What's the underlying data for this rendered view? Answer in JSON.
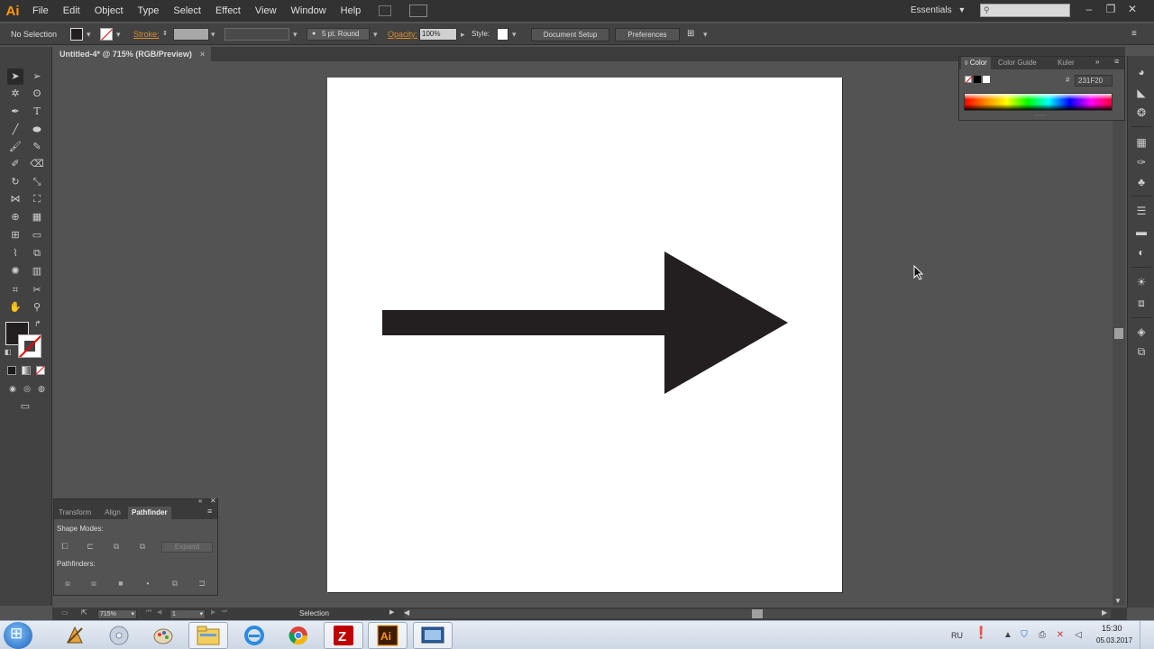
{
  "app": {
    "logo": "Ai",
    "title": "Adobe Illustrator"
  },
  "menu": [
    "File",
    "Edit",
    "Object",
    "Type",
    "Select",
    "Effect",
    "View",
    "Window",
    "Help"
  ],
  "workspace": {
    "label": "Essentials",
    "arrow": "▾"
  },
  "control_bar": {
    "selection_label": "No Selection",
    "stroke_label": "Stroke:",
    "brush_label": "5 pt. Round",
    "opacity_label": "Opacity:",
    "opacity_value": "100%",
    "style_label": "Style:",
    "document_setup": "Document Setup",
    "preferences": "Preferences"
  },
  "document_tab": {
    "title": "Untitled-4* @ 715% (RGB/Preview)",
    "close": "×"
  },
  "color_panel": {
    "tabs": [
      "Color",
      "Color Guide",
      "Kuler"
    ],
    "hex_value": "231F20"
  },
  "pathfinder_panel": {
    "tabs": [
      "Transform",
      "Align",
      "Pathfinder"
    ],
    "shape_modes_label": "Shape Modes:",
    "pathfinders_label": "Pathfinders:",
    "expand_label": "Expand"
  },
  "status_bar": {
    "zoom": "715%",
    "page": "1",
    "status": "Selection"
  },
  "taskbar": {
    "language": "RU",
    "time": "15:30",
    "date": "05.03.2017"
  },
  "colors": {
    "fill": "#231f20",
    "app_accent": "#ff9a00",
    "background": "#535353",
    "artboard": "#ffffff"
  },
  "icons": {
    "tools": [
      "selection-tool-icon",
      "direct-selection-tool-icon",
      "magic-wand-icon",
      "lasso-icon",
      "pen-tool-icon",
      "type-tool-icon",
      "line-tool-icon",
      "ellipse-tool-icon",
      "paintbrush-icon",
      "pencil-icon",
      "blob-brush-icon",
      "eraser-icon",
      "rotate-icon",
      "scale-icon",
      "width-icon",
      "free-transform-icon",
      "shape-builder-icon",
      "perspective-grid-icon",
      "mesh-icon",
      "gradient-icon",
      "eyedropper-icon",
      "blend-icon",
      "symbol-sprayer-icon",
      "column-graph-icon",
      "artboard-tool-icon",
      "slice-icon",
      "hand-icon",
      "zoom-icon"
    ]
  }
}
